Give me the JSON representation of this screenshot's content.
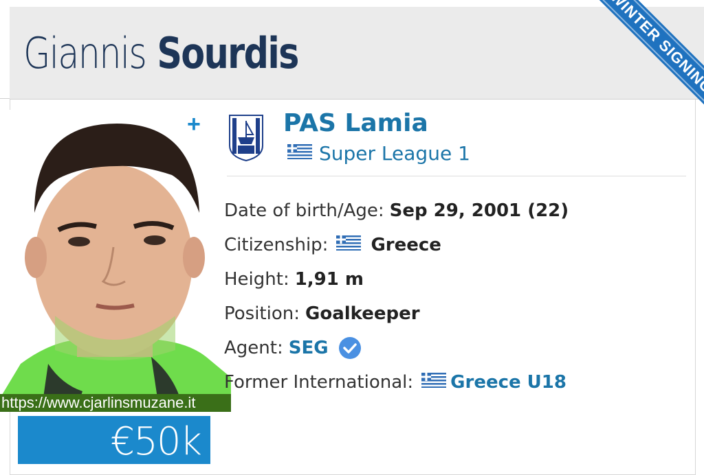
{
  "header": {
    "first_name": "Giannis",
    "last_name": "Sourdis",
    "ribbon": "WINTER SIGNING"
  },
  "club": {
    "name": "PAS Lamia",
    "league": "Super League 1"
  },
  "details": {
    "dob_label": "Date of birth/Age:",
    "dob_value": "Sep 29, 2001 (22)",
    "citizenship_label": "Citizenship:",
    "citizenship_value": "Greece",
    "height_label": "Height:",
    "height_value": "1,91 m",
    "position_label": "Position:",
    "position_value": "Goalkeeper",
    "agent_label": "Agent:",
    "agent_value": "SEG",
    "former_intl_label": "Former International:",
    "former_intl_value": "Greece U18"
  },
  "watermark": "https://www.cjarlinsmuzane.it",
  "market_value": "€50k",
  "icons": {
    "plus": "+",
    "flag": "greece-flag-icon",
    "crest": "club-crest-icon",
    "verified": "verified-check-icon"
  },
  "colors": {
    "name_text": "#1d3557",
    "link_blue": "#1b75a8",
    "ribbon_blue": "#1f72bf",
    "value_box": "#1b89cc",
    "jersey_green": "#6fdc4c",
    "watermark_bg": "#3a6f18"
  }
}
